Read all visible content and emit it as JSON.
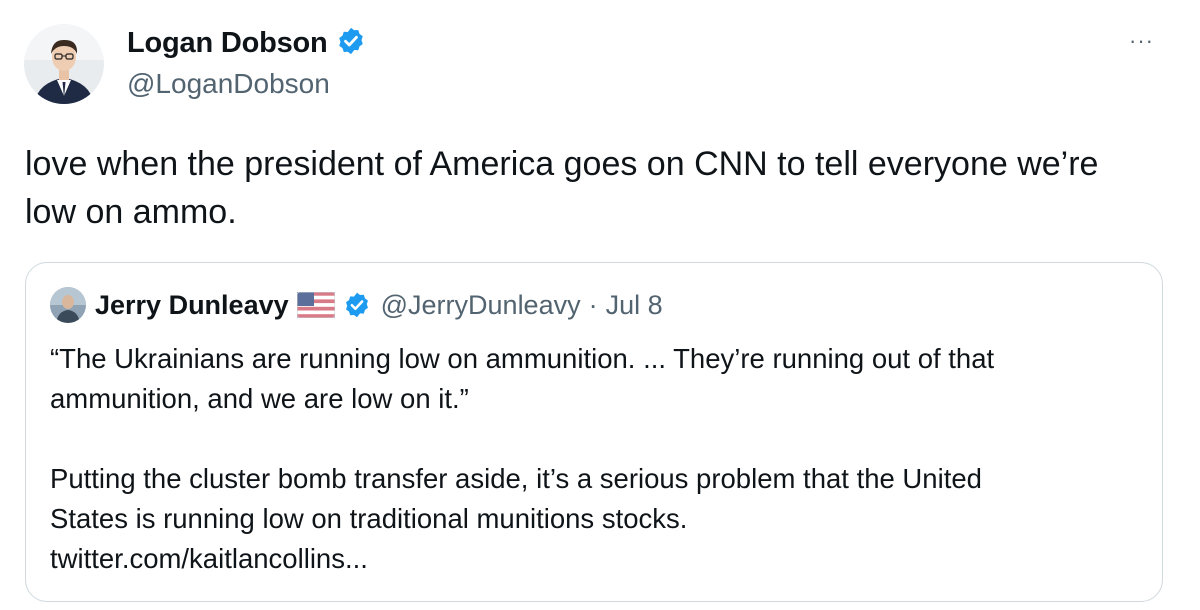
{
  "author": {
    "display_name": "Logan Dobson",
    "handle": "@LoganDobson",
    "verified_icon": "verified-badge-icon"
  },
  "more_icon": "ellipsis-icon",
  "more_label": "···",
  "tweet": {
    "line1": "love when the president of America goes on CNN to tell everyone we’re",
    "line2": "low on ammo."
  },
  "quote": {
    "display_name": "Jerry Dunleavy",
    "flag_icon": "us-flag-icon",
    "verified_icon": "verified-badge-icon",
    "handle": "@JerryDunleavy",
    "separator": "·",
    "date": "Jul 8",
    "line1": "“The Ukrainians are running low on ammunition. ... They’re running out of that",
    "line2": "ammunition, and we are low on it.”",
    "line3": "Putting the cluster bomb transfer aside, it’s a serious problem that the United",
    "line4": "States is running low on traditional munitions stocks.",
    "link": "twitter.com/kaitlancollins..."
  },
  "colors": {
    "text": "#0f1419",
    "secondary": "#536471",
    "verified": "#1d9bf0",
    "border": "#cfd9de"
  }
}
